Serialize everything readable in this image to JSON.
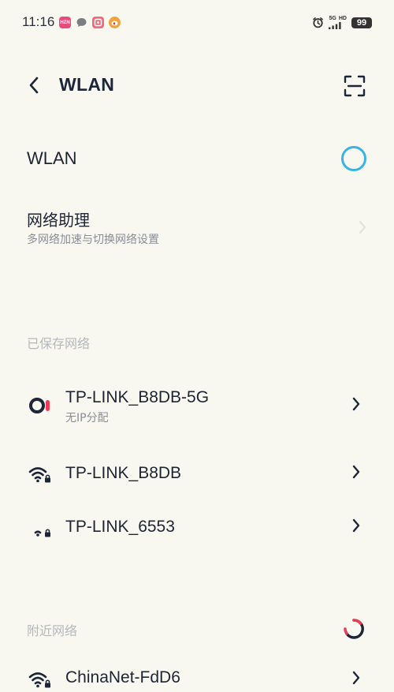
{
  "status_bar": {
    "time": "11:16",
    "notification_icons": [
      "hz-app-icon",
      "message-icon",
      "app-icon",
      "weibo-icon"
    ],
    "hz_icon_text": "HZN",
    "network_text": [
      "5G",
      "HD"
    ],
    "battery": "99"
  },
  "header": {
    "title": "WLAN"
  },
  "wlan_toggle": {
    "label": "WLAN",
    "accent_color": "#3bb3e6"
  },
  "network_assistant": {
    "title": "网络助理",
    "subtitle": "多网络加速与切换网络设置"
  },
  "saved_networks": {
    "header": "已保存网络",
    "items": [
      {
        "name": "TP-LINK_B8DB-5G",
        "status": "无IP分配",
        "icon": "connecting-icon"
      },
      {
        "name": "TP-LINK_B8DB",
        "status": "",
        "icon": "wifi-locked-icon"
      },
      {
        "name": "TP-LINK_6553",
        "status": "",
        "icon": "wifi-weak-locked-icon"
      }
    ]
  },
  "nearby_networks": {
    "header": "附近网络",
    "items": [
      {
        "name": "ChinaNet-FdD6",
        "status": "",
        "icon": "wifi-locked-icon"
      }
    ]
  }
}
